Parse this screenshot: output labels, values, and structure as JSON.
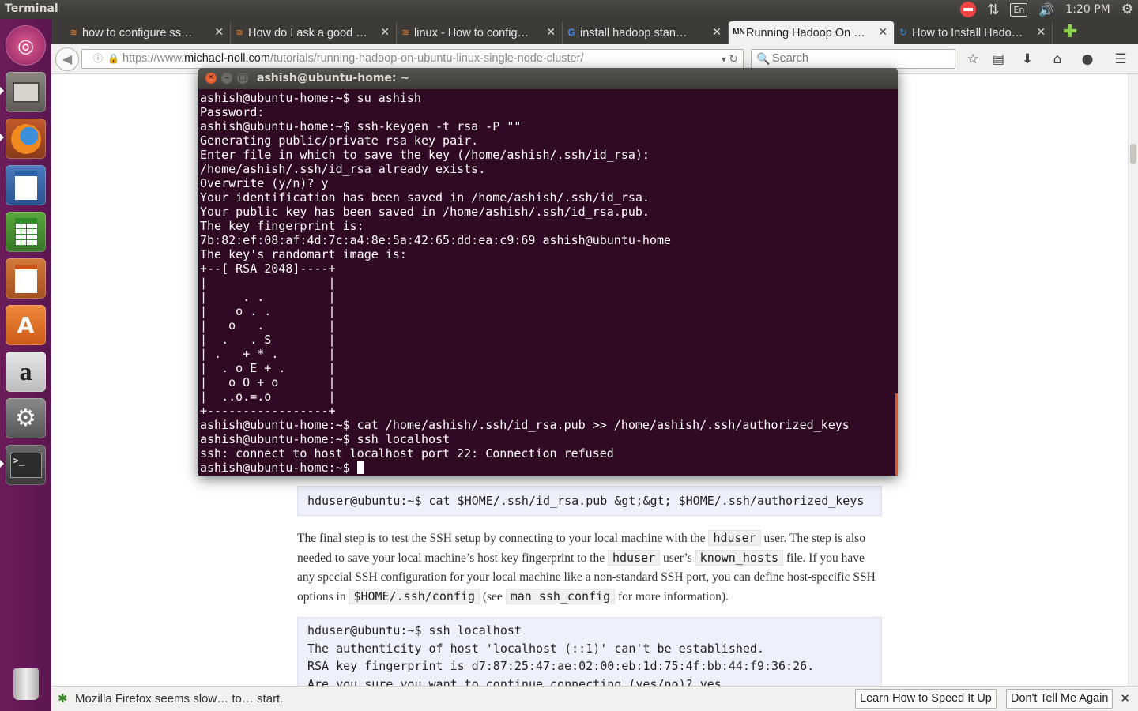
{
  "top_panel": {
    "app_title": "Terminal",
    "keyboard_layout": "En",
    "clock": "1:20 PM"
  },
  "launcher": {
    "items": [
      "Ubuntu Dash",
      "Files",
      "Firefox",
      "LibreOffice Writer",
      "LibreOffice Calc",
      "LibreOffice Impress",
      "Ubuntu Software Center",
      "Amazon",
      "System Settings",
      "Terminal",
      "Trash"
    ]
  },
  "browser": {
    "tabs": [
      {
        "label": "how to configure ss…",
        "favicon": "stackexchange-icon"
      },
      {
        "label": "How do I ask a good …",
        "favicon": "stackexchange-icon"
      },
      {
        "label": "linux - How to config…",
        "favicon": "stackexchange-icon"
      },
      {
        "label": "install hadoop stan…",
        "favicon": "google-icon"
      },
      {
        "label": "Running Hadoop On …",
        "favicon": "MN"
      },
      {
        "label": "How to Install Hado…",
        "favicon": "loading-icon"
      }
    ],
    "url": {
      "prefix": "https://www.",
      "host": "michael-noll.com",
      "path": "/tutorials/running-hadoop-on-ubuntu-linux-single-node-cluster/"
    },
    "search_placeholder": "Search"
  },
  "page": {
    "code1": "hduser@ubuntu:~$ cat $HOME/.ssh/id_rsa.pub &gt;&gt; $HOME/.ssh/authorized_keys",
    "para": {
      "t1": "The final step is to test the SSH setup by connecting to your local machine with the ",
      "c1": "hduser",
      "t2": " user. The step is also needed to save your local machine’s host key fingerprint to the ",
      "c2": "hduser",
      "t3": " user’s ",
      "c3": "known_hosts",
      "t4": " file. If you have any special SSH configuration for your local machine like a non-standard SSH port, you can define host-specific SSH options in ",
      "c4": "$HOME/.ssh/config",
      "t5": " (see ",
      "c5": "man ssh_config",
      "t6": " for more information)."
    },
    "code2": [
      "hduser@ubuntu:~$ ssh localhost",
      "The authenticity of host 'localhost (::1)' can't be established.",
      "RSA key fingerprint is d7:87:25:47:ae:02:00:eb:1d:75:4f:bb:44:f9:36:26.",
      "Are you sure you want to continue connecting (yes/no)? yes"
    ]
  },
  "notification": {
    "message": "Mozilla Firefox seems slow… to… start.",
    "learn_button": "Learn How to Speed It Up",
    "dismiss_button": "Don't Tell Me Again"
  },
  "terminal": {
    "title": "ashish@ubuntu-home: ~",
    "lines": [
      "ashish@ubuntu-home:~$ su ashish",
      "Password: ",
      "ashish@ubuntu-home:~$ ssh-keygen -t rsa -P \"\"",
      "Generating public/private rsa key pair.",
      "Enter file in which to save the key (/home/ashish/.ssh/id_rsa): ",
      "/home/ashish/.ssh/id_rsa already exists.",
      "Overwrite (y/n)? y",
      "Your identification has been saved in /home/ashish/.ssh/id_rsa.",
      "Your public key has been saved in /home/ashish/.ssh/id_rsa.pub.",
      "The key fingerprint is:",
      "7b:82:ef:08:af:4d:7c:a4:8e:5a:42:65:dd:ea:c9:69 ashish@ubuntu-home",
      "The key's randomart image is:",
      "+--[ RSA 2048]----+",
      "|                 |",
      "|     . .         |",
      "|    o . .        |",
      "|   o   .         |",
      "|  .   . S        |",
      "| .   + * .       |",
      "|  . o E + .      |",
      "|   o O + o       |",
      "|  ..o.=.o        |",
      "+-----------------+",
      "ashish@ubuntu-home:~$ cat /home/ashish/.ssh/id_rsa.pub >> /home/ashish/.ssh/authorized_keys",
      "ashish@ubuntu-home:~$ ssh localhost",
      "ssh: connect to host localhost port 22: Connection refused"
    ],
    "prompt": "ashish@ubuntu-home:~$ "
  }
}
